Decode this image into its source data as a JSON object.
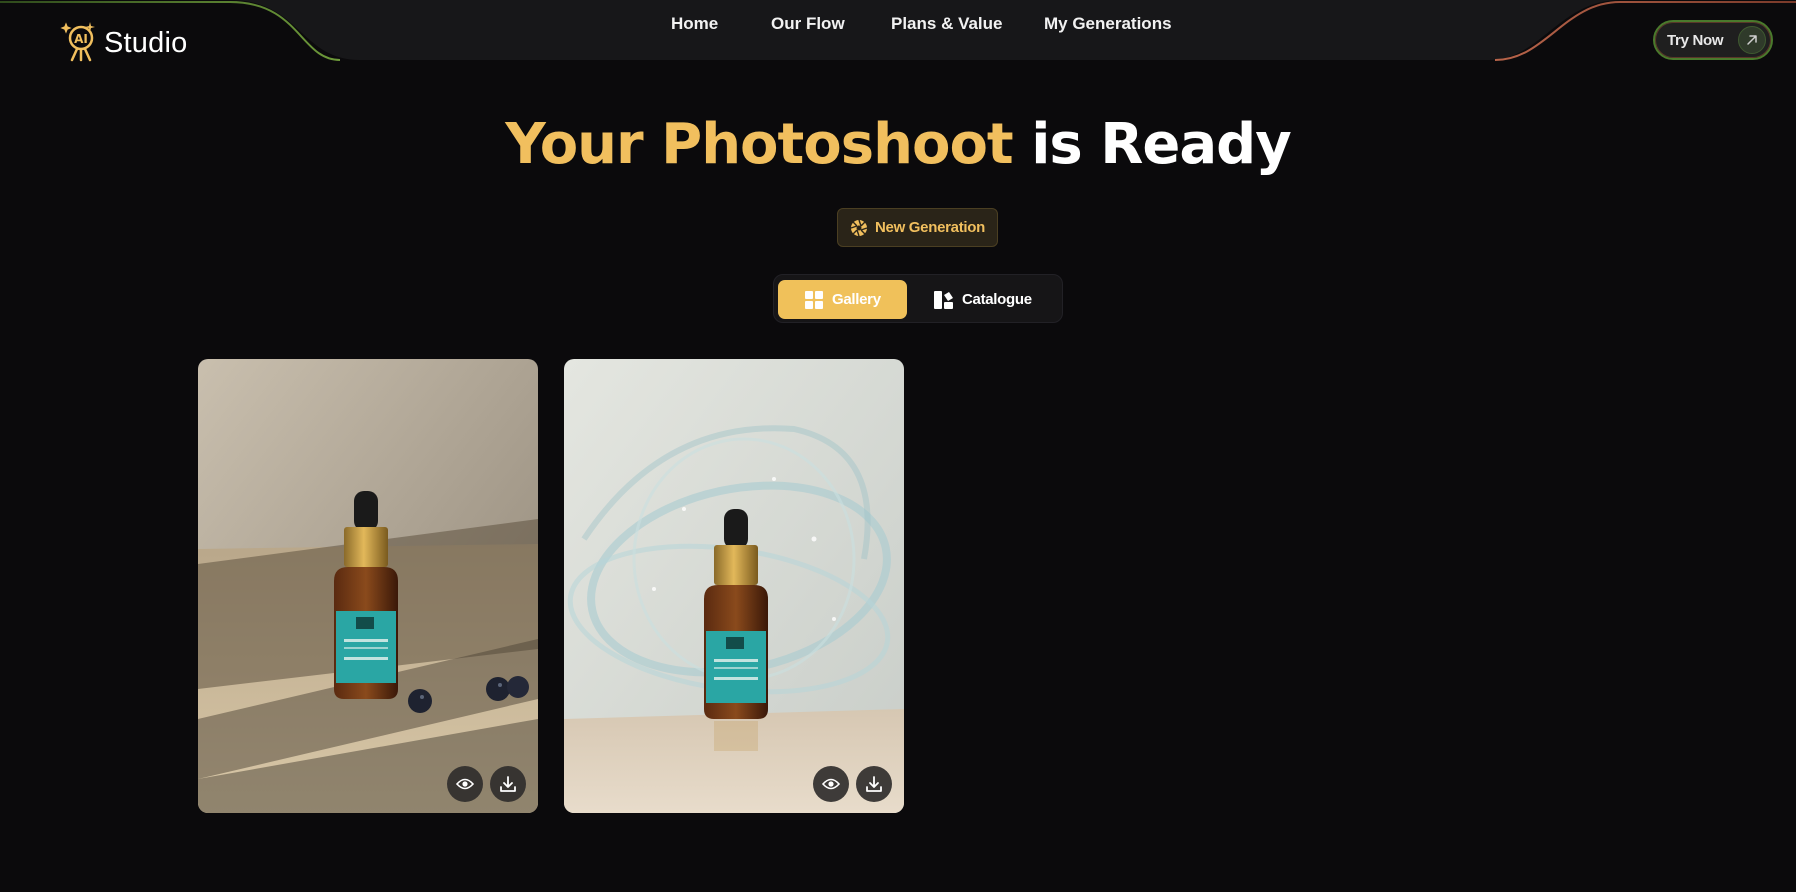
{
  "brand": {
    "logo_badge": "AI",
    "name": "Studio"
  },
  "nav": {
    "links": [
      "Home",
      "Our Flow",
      "Plans & Value",
      "My Generations"
    ],
    "cta_label": "Try Now"
  },
  "hero": {
    "title_accent": "Your Photoshoot",
    "title_rest": "is Ready",
    "new_generation_label": "New Generation"
  },
  "view_toggle": {
    "options": [
      "Gallery",
      "Catalogue"
    ],
    "selected": "Gallery"
  },
  "gallery": {
    "images": [
      {
        "scene": "serum bottle on beige surface with blueberries and window shadow",
        "actions": [
          "view-icon",
          "download-icon"
        ]
      },
      {
        "scene": "serum bottle with water splash swirl",
        "actions": [
          "view-icon",
          "download-icon"
        ]
      }
    ]
  },
  "colors": {
    "background": "#0b0a0c",
    "accent": "#f1bf5e",
    "nav_bar": "#171719"
  }
}
